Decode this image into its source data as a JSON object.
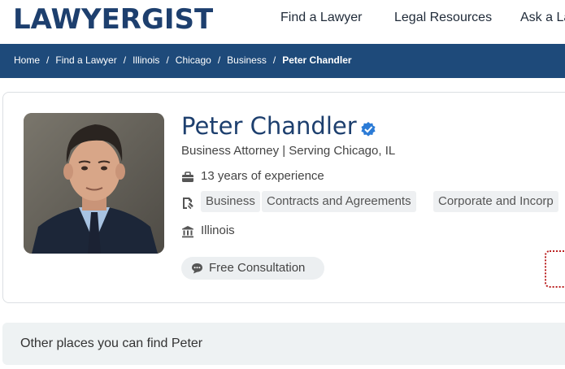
{
  "header": {
    "logo": "LAWYERGIST",
    "nav": [
      "Find a Lawyer",
      "Legal Resources",
      "Ask a La"
    ]
  },
  "breadcrumb": [
    "Home",
    "Find a Lawyer",
    "Illinois",
    "Chicago",
    "Business",
    "Peter Chandler"
  ],
  "breadcrumb_separator": "/",
  "profile": {
    "name": "Peter Chandler",
    "verified_icon": "verified-badge-icon",
    "subtitle": "Business Attorney | Serving Chicago, IL",
    "experience": "13 years of experience",
    "practice_areas": [
      "Business",
      "Contracts and Agreements",
      "Corporate and Incorp"
    ],
    "state": "Illinois",
    "consultation": "Free Consultation"
  },
  "other_places": "Other places you can find Peter",
  "colors": {
    "brand_navy": "#1d3f6e",
    "breadcrumb_bar": "#1e4a7a",
    "verified_blue": "#2b7bd6"
  }
}
